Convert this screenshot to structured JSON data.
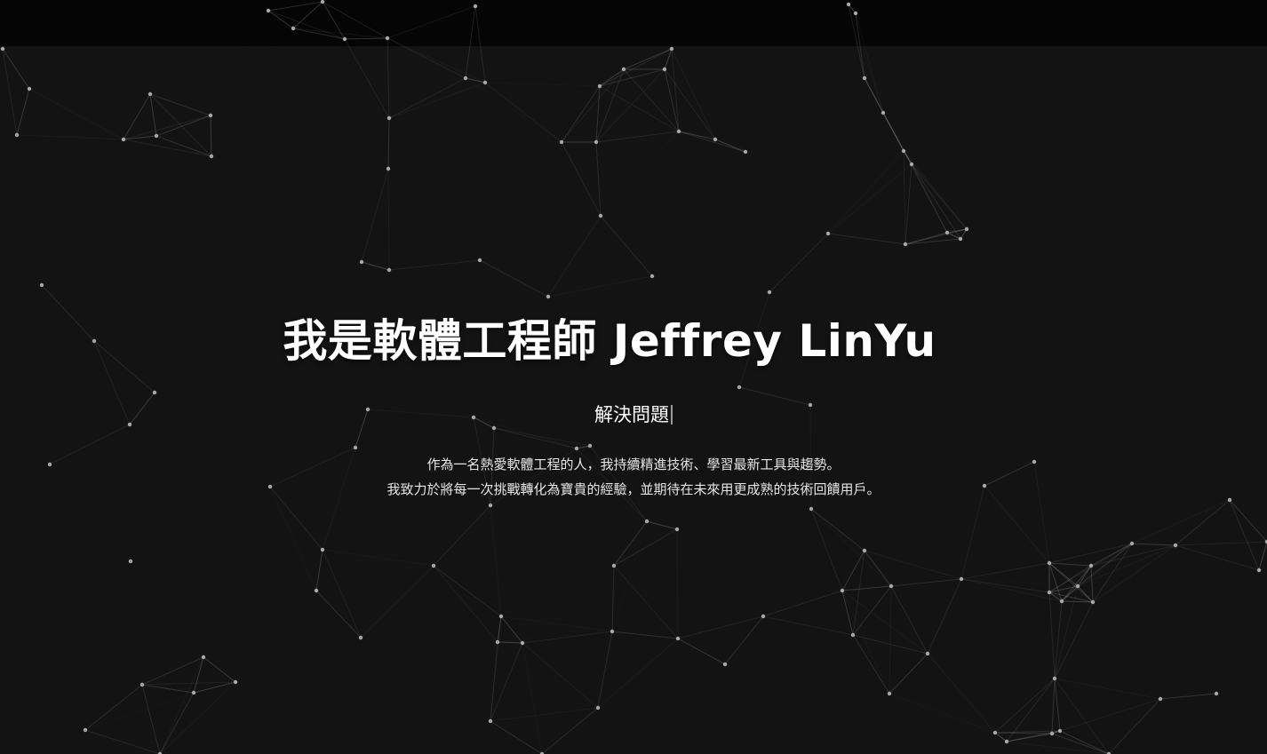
{
  "hero": {
    "title": "我是軟體工程師 Jeffrey LinYu",
    "typed_text": "解決問題",
    "description_lines": [
      "作為一名熱愛軟體工程的人，我持續精進技術、學習最新工具與趨勢。",
      "我致力於將每一次挑戰轉化為寶貴的經驗，並期待在未來用更成熟的技術回饋用戶。"
    ]
  },
  "colors": {
    "background": "#131313",
    "topbar": "#050505",
    "text": "#ffffff",
    "particle": "#a9a9a9"
  }
}
